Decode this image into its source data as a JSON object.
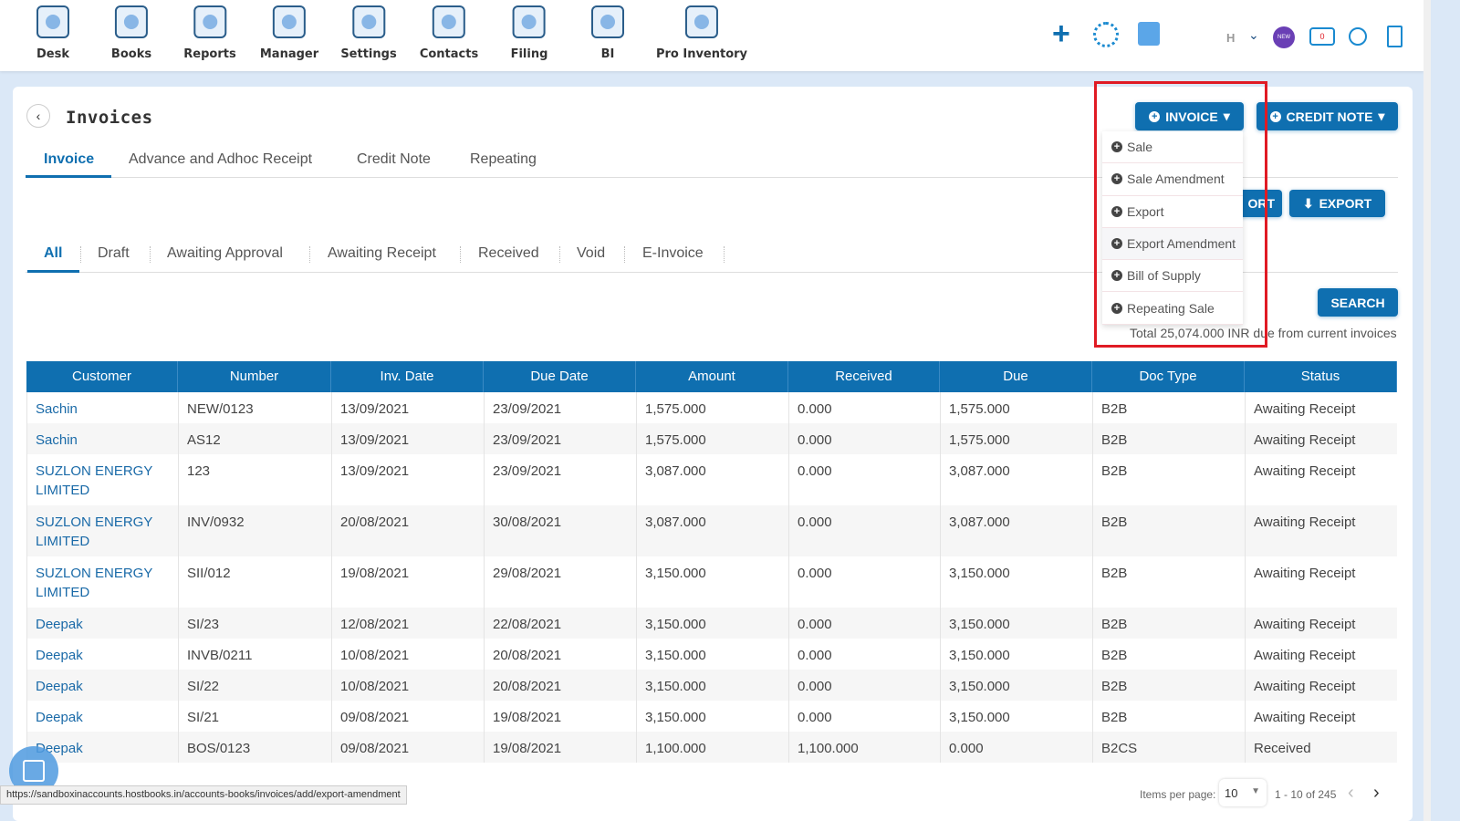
{
  "nav": [
    {
      "label": "Desk"
    },
    {
      "label": "Books"
    },
    {
      "label": "Reports"
    },
    {
      "label": "Manager"
    },
    {
      "label": "Settings"
    },
    {
      "label": "Contacts"
    },
    {
      "label": "Filing"
    },
    {
      "label": "BI"
    },
    {
      "label": "Pro Inventory"
    }
  ],
  "topright": {
    "user_initial": "H",
    "new_badge": "NEW",
    "notif_count": "0"
  },
  "page": {
    "title": "Invoices"
  },
  "tabs": [
    "Invoice",
    "Advance and Adhoc Receipt",
    "Credit Note",
    "Repeating"
  ],
  "subtabs": [
    "All",
    "Draft",
    "Awaiting Approval",
    "Awaiting Receipt",
    "Received",
    "Void",
    "E-Invoice"
  ],
  "buttons": {
    "invoice": "INVOICE",
    "credit_note": "CREDIT NOTE",
    "import": "ORT",
    "export": "EXPORT",
    "search": "SEARCH"
  },
  "invoice_menu": [
    "Sale",
    "Sale Amendment",
    "Export",
    "Export Amendment",
    "Bill of Supply",
    "Repeating Sale"
  ],
  "total_text": "Total 25,074.000 INR due from current invoices",
  "table": {
    "columns": [
      "Customer",
      "Number",
      "Inv. Date",
      "Due Date",
      "Amount",
      "Received",
      "Due",
      "Doc Type",
      "Status"
    ],
    "rows": [
      [
        "Sachin",
        "NEW/0123",
        "13/09/2021",
        "23/09/2021",
        "1,575.000",
        "0.000",
        "1,575.000",
        "B2B",
        "Awaiting Receipt"
      ],
      [
        "Sachin",
        "AS12",
        "13/09/2021",
        "23/09/2021",
        "1,575.000",
        "0.000",
        "1,575.000",
        "B2B",
        "Awaiting Receipt"
      ],
      [
        "SUZLON ENERGY LIMITED",
        "123",
        "13/09/2021",
        "23/09/2021",
        "3,087.000",
        "0.000",
        "3,087.000",
        "B2B",
        "Awaiting Receipt"
      ],
      [
        "SUZLON ENERGY LIMITED",
        "INV/0932",
        "20/08/2021",
        "30/08/2021",
        "3,087.000",
        "0.000",
        "3,087.000",
        "B2B",
        "Awaiting Receipt"
      ],
      [
        "SUZLON ENERGY LIMITED",
        "SII/012",
        "19/08/2021",
        "29/08/2021",
        "3,150.000",
        "0.000",
        "3,150.000",
        "B2B",
        "Awaiting Receipt"
      ],
      [
        "Deepak",
        "SI/23",
        "12/08/2021",
        "22/08/2021",
        "3,150.000",
        "0.000",
        "3,150.000",
        "B2B",
        "Awaiting Receipt"
      ],
      [
        "Deepak",
        "INVB/0211",
        "10/08/2021",
        "20/08/2021",
        "3,150.000",
        "0.000",
        "3,150.000",
        "B2B",
        "Awaiting Receipt"
      ],
      [
        "Deepak",
        "SI/22",
        "10/08/2021",
        "20/08/2021",
        "3,150.000",
        "0.000",
        "3,150.000",
        "B2B",
        "Awaiting Receipt"
      ],
      [
        "Deepak",
        "SI/21",
        "09/08/2021",
        "19/08/2021",
        "3,150.000",
        "0.000",
        "3,150.000",
        "B2B",
        "Awaiting Receipt"
      ],
      [
        "Deepak",
        "BOS/0123",
        "09/08/2021",
        "19/08/2021",
        "1,100.000",
        "1,100.000",
        "0.000",
        "B2CS",
        "Received"
      ]
    ]
  },
  "pagination": {
    "label": "Items per page:",
    "per_page": "10",
    "range": "1 - 10 of 245"
  },
  "status_url": "https://sandboxinaccounts.hostbooks.in/accounts-books/invoices/add/export-amendment",
  "colors": {
    "primary": "#0f6fb0",
    "highlight": "#e01b24",
    "link": "#1a6aa8"
  }
}
